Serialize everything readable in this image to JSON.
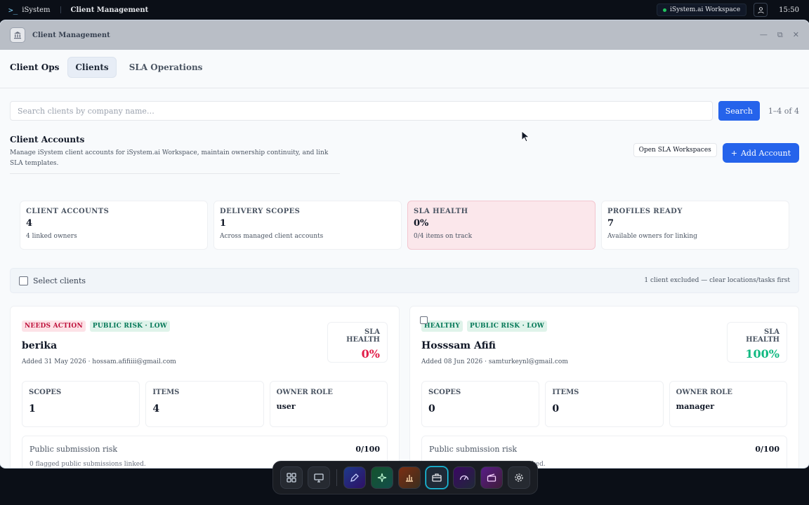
{
  "system_bar": {
    "brand": "iSystem",
    "app_title": "Client Management",
    "workspace": "iSystem.ai Workspace",
    "time": "15:50"
  },
  "window": {
    "title": "Client Management"
  },
  "tabs": {
    "section": "Client Ops",
    "items": [
      {
        "label": "Clients",
        "active": true
      },
      {
        "label": "SLA Operations",
        "active": false
      }
    ]
  },
  "search": {
    "placeholder": "Search clients by company name…",
    "button": "Search",
    "count": "1–4 of 4"
  },
  "accounts": {
    "title": "Client Accounts",
    "description": "Manage iSystem client accounts for iSystem.ai Workspace, maintain ownership continuity, and link SLA templates.",
    "open_sla_button": "Open SLA Workspaces",
    "add_button": "Add Account"
  },
  "stats": [
    {
      "label": "CLIENT ACCOUNTS",
      "value": "4",
      "sub": "4 linked owners"
    },
    {
      "label": "DELIVERY SCOPES",
      "value": "1",
      "sub": "Across managed client accounts"
    },
    {
      "label": "SLA HEALTH",
      "value": "0%",
      "sub": "0/4 items on track"
    },
    {
      "label": "PROFILES READY",
      "value": "7",
      "sub": "Available owners for linking"
    }
  ],
  "select_bar": {
    "label": "Select clients",
    "note": "1 client excluded — clear locations/tasks first"
  },
  "clients": [
    {
      "status": "NEEDS ACTION",
      "risk": "PUBLIC RISK · LOW",
      "name": "berika",
      "meta": "Added 31 May 2026 · hossam.afifiiii@gmail.com",
      "sla_label": "SLA HEALTH",
      "sla_value": "0%",
      "scopes_label": "SCOPES",
      "scopes": "1",
      "items_label": "ITEMS",
      "items": "4",
      "role_label": "OWNER ROLE",
      "role": "user",
      "risk_label": "Public submission risk",
      "risk_score": "0/100",
      "risk_sub": "0 flagged public submissions linked."
    },
    {
      "status": "HEALTHY",
      "risk": "PUBLIC RISK · LOW",
      "name": "Hosssam Afifi",
      "meta": "Added 08 Jun 2026 · samturkeynl@gmail.com",
      "sla_label": "SLA HEALTH",
      "sla_value": "100%",
      "scopes_label": "SCOPES",
      "scopes": "0",
      "items_label": "ITEMS",
      "items": "0",
      "role_label": "OWNER ROLE",
      "role": "manager",
      "risk_label": "Public submission risk",
      "risk_score": "0/100",
      "risk_sub": "0 flagged public submissions linked."
    }
  ],
  "colors": {
    "accent": "#2563eb",
    "danger": "#e11d48",
    "success": "#10b981"
  },
  "dock": [
    "grid-icon",
    "monitor-icon",
    "pen-icon",
    "sparkle-icon",
    "chart-icon",
    "briefcase-icon",
    "gauge-icon",
    "clapper-icon",
    "gear-icon"
  ]
}
